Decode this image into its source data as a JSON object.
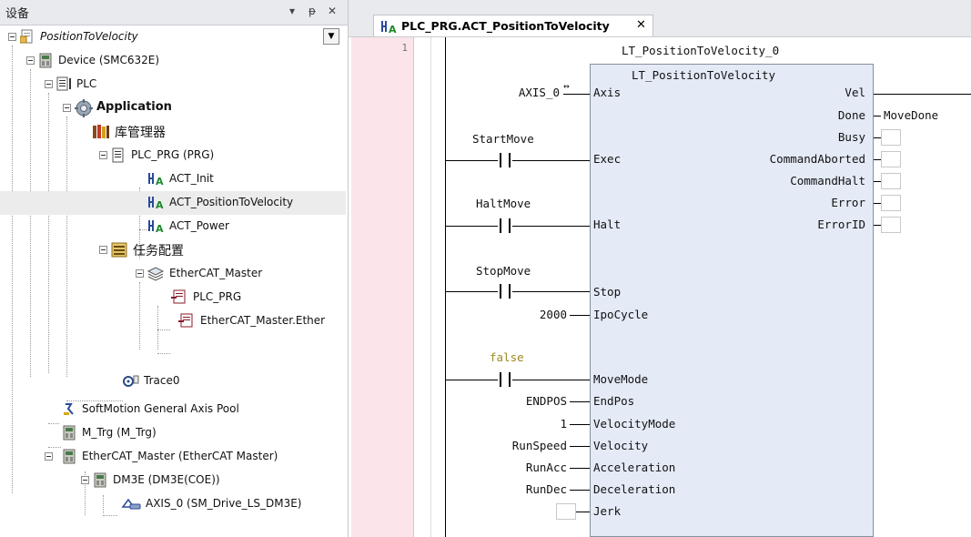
{
  "left_panel": {
    "title": "设备",
    "header_buttons": [
      "▾",
      "ᵽ",
      "✕"
    ],
    "tree": [
      {
        "label": "PositionToVelocity",
        "italic": true
      },
      {
        "label": "Device (SMC632E)"
      },
      {
        "label": "PLC"
      },
      {
        "label": "Application",
        "bold": true
      },
      {
        "label": "库管理器"
      },
      {
        "label": "PLC_PRG (PRG)"
      },
      {
        "label": "ACT_Init"
      },
      {
        "label": "ACT_PositionToVelocity",
        "selected": true
      },
      {
        "label": "ACT_Power"
      },
      {
        "label": "任务配置"
      },
      {
        "label": "EtherCAT_Master"
      },
      {
        "label": "PLC_PRG"
      },
      {
        "label": "EtherCAT_Master.Ether"
      },
      {
        "label": "Trace0"
      },
      {
        "label": "SoftMotion General Axis Pool"
      },
      {
        "label": "M_Trg (M_Trg)"
      },
      {
        "label": "EtherCAT_Master (EtherCAT Master)"
      },
      {
        "label": "DM3E (DM3E(COE))"
      },
      {
        "label": "AXIS_0 (SM_Drive_LS_DM3E)"
      }
    ]
  },
  "editor": {
    "tab_label": "PLC_PRG.ACT_PositionToVelocity",
    "tab_close": "✕",
    "line_number": "1",
    "instance_name": "LT_PositionToVelocity_0",
    "fb_type": "LT_PositionToVelocity",
    "inputs": {
      "axis": {
        "pin": "Axis",
        "var": "AXIS_0"
      },
      "exec": {
        "pin": "Exec",
        "var": "StartMove"
      },
      "halt": {
        "pin": "Halt",
        "var": "HaltMove"
      },
      "stop": {
        "pin": "Stop",
        "var": "StopMove"
      },
      "ipocycle": {
        "pin": "IpoCycle",
        "var": "2000"
      },
      "movemode": {
        "pin": "MoveMode",
        "var": "false"
      },
      "endpos": {
        "pin": "EndPos",
        "var": "ENDPOS"
      },
      "velocitymode": {
        "pin": "VelocityMode",
        "var": "1"
      },
      "velocity": {
        "pin": "Velocity",
        "var": "RunSpeed"
      },
      "acceleration": {
        "pin": "Acceleration",
        "var": "RunAcc"
      },
      "deceleration": {
        "pin": "Deceleration",
        "var": "RunDec"
      },
      "jerk": {
        "pin": "Jerk",
        "var": ""
      }
    },
    "outputs": {
      "vel": {
        "pin": "Vel",
        "var": ""
      },
      "done": {
        "pin": "Done",
        "var": "MoveDone"
      },
      "busy": {
        "pin": "Busy"
      },
      "commandaborted": {
        "pin": "CommandAborted"
      },
      "commandhalt": {
        "pin": "CommandHalt"
      },
      "error": {
        "pin": "Error"
      },
      "errorid": {
        "pin": "ErrorID"
      }
    },
    "colors": {
      "false_literal": "#a08a22",
      "fb_fill": "#e4eaf6",
      "gutter": "#fbe4ea"
    }
  }
}
